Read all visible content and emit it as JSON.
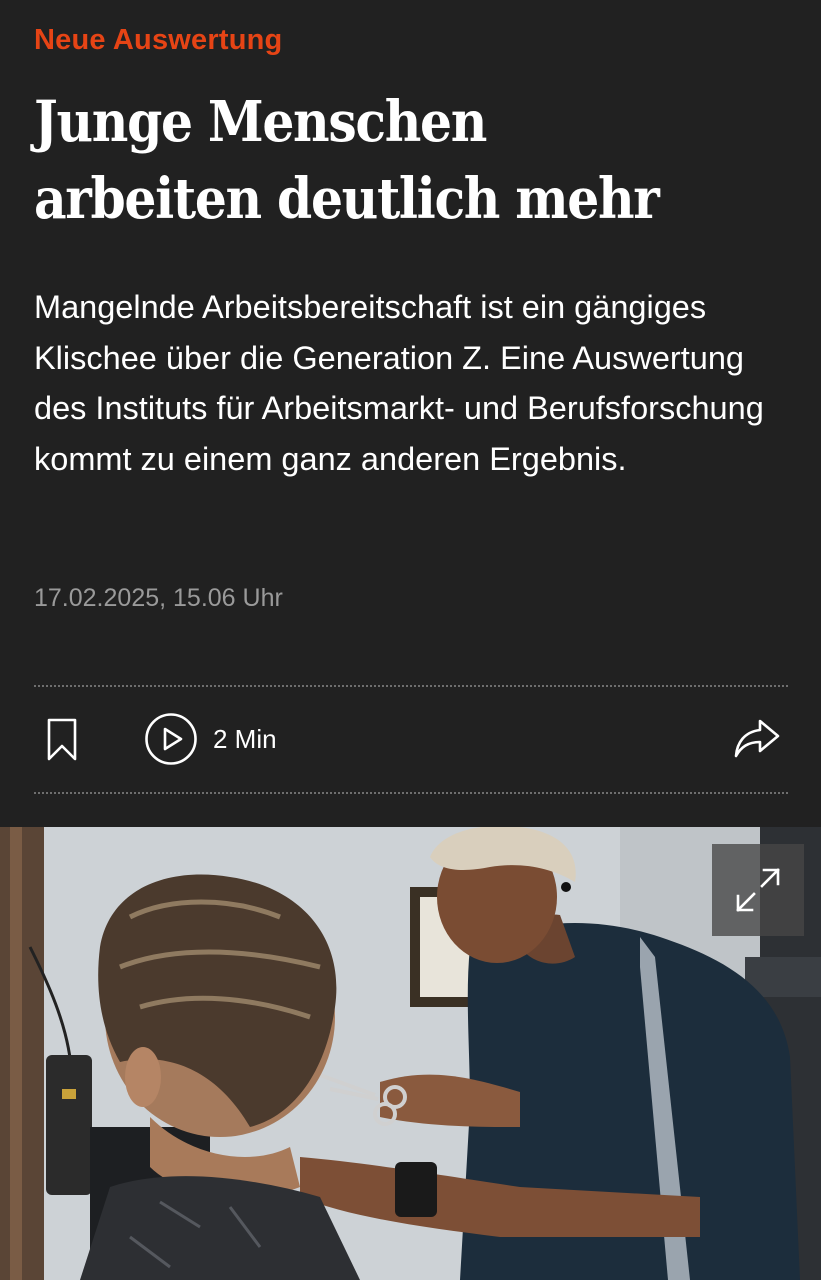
{
  "article": {
    "kicker": "Neue Auswertung",
    "headline": "Junge Menschen arbeiten deutlich mehr",
    "teaser": "Mangelnde Arbeitsbereitschaft ist ein gängiges Klischee über die Generation Z. Eine Auswertung des Instituts für Arbeitsmarkt- und Berufsforschung kommt zu einem ganz anderen Ergebnis.",
    "timestamp": "17.02.2025, 15.06 Uhr"
  },
  "actions": {
    "bookmark_icon": "bookmark-icon",
    "play_icon": "play-circle-icon",
    "play_duration": "2 Min",
    "share_icon": "share-icon"
  },
  "hero_image": {
    "subject": "barber cutting a customer's hair",
    "expand_icon": "expand-icon"
  },
  "colors": {
    "background": "#212121",
    "kicker": "#e64415",
    "text": "#ffffff",
    "meta": "#9a9a9a"
  }
}
